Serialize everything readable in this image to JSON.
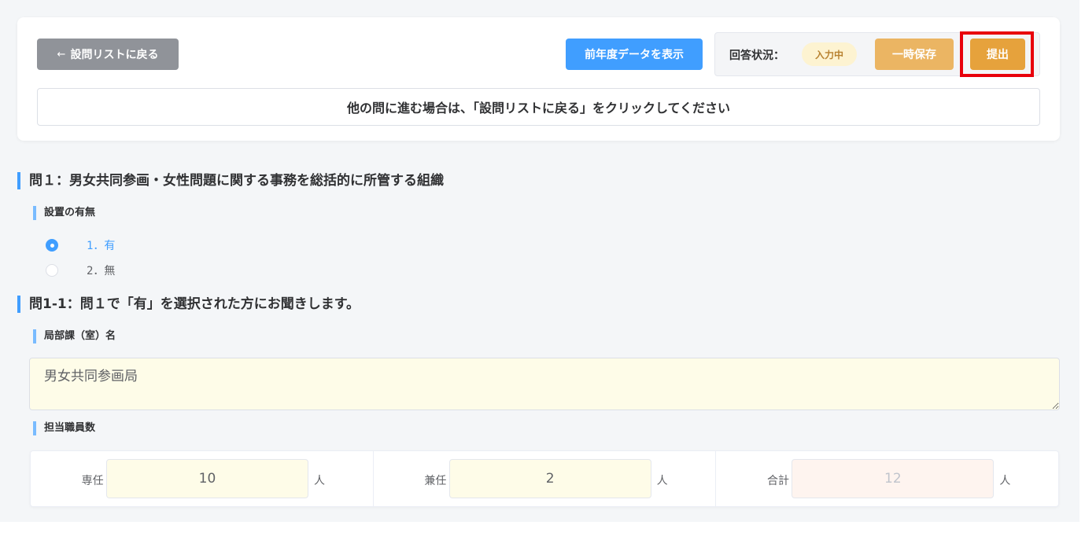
{
  "header": {
    "back_label": "設問リストに戻る",
    "back_arrow": "←",
    "prev_data_label": "前年度データを表示",
    "status_label": "回答状況：",
    "status_badge": "入力中",
    "save_label": "一時保存",
    "submit_label": "提出",
    "notice": "他の問に進む場合は、「設問リストに戻る」をクリックしてください"
  },
  "q1": {
    "title": "問１：男女共同参画・女性問題に関する事務を総括的に所管する組織",
    "sub_label": "設置の有無",
    "options": [
      {
        "label": "1．有",
        "checked": true
      },
      {
        "label": "2．無",
        "checked": false
      }
    ]
  },
  "q1_1": {
    "title": "問1-1：問１で「有」を選択された方にお聞きします。",
    "dept_label": "局部課（室）名",
    "dept_value": "男女共同参画局",
    "staff_label": "担当職員数",
    "staff": [
      {
        "label": "専任",
        "value": "10",
        "unit": "人"
      },
      {
        "label": "兼任",
        "value": "2",
        "unit": "人"
      },
      {
        "label": "合計",
        "value": "12",
        "unit": "人"
      }
    ]
  },
  "colors": {
    "primary": "#409eff",
    "warning": "#e6a23c",
    "info": "#909399",
    "highlight": "#e8000b"
  }
}
